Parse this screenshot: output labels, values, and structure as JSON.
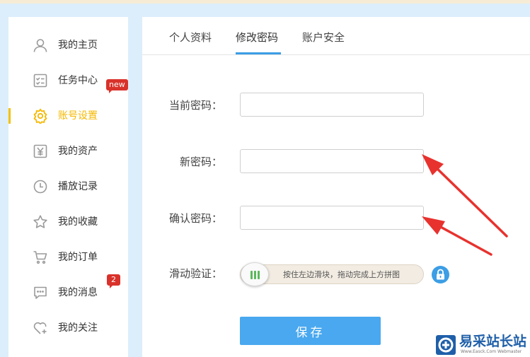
{
  "sidebar": {
    "items": [
      {
        "label": "我的主页",
        "icon": "user-icon"
      },
      {
        "label": "任务中心",
        "icon": "task-list-icon",
        "badge": "new"
      },
      {
        "label": "账号设置",
        "icon": "gear-icon",
        "active": true
      },
      {
        "label": "我的资产",
        "icon": "yen-icon"
      },
      {
        "label": "播放记录",
        "icon": "clock-icon"
      },
      {
        "label": "我的收藏",
        "icon": "star-icon"
      },
      {
        "label": "我的订单",
        "icon": "cart-icon"
      },
      {
        "label": "我的消息",
        "icon": "message-icon",
        "badge": "2"
      },
      {
        "label": "我的关注",
        "icon": "heart-plus-icon"
      }
    ]
  },
  "tabs": [
    {
      "label": "个人资料"
    },
    {
      "label": "修改密码",
      "active": true
    },
    {
      "label": "账户安全"
    }
  ],
  "form": {
    "current_password_label": "当前密码：",
    "new_password_label": "新密码：",
    "confirm_password_label": "确认密码：",
    "slider_label": "滑动验证：",
    "slider_hint": "按住左边滑块，拖动完成上方拼图",
    "save_label": "保存"
  },
  "watermark": {
    "title": "易采站长站",
    "subtitle": "Www.Easck.Com Webmaster"
  },
  "colors": {
    "accent": "#3c9ee5",
    "active_sidebar": "#f5b800",
    "badge": "#d9322b",
    "save_button": "#49a8ef",
    "annotation_arrow": "#e8322e"
  }
}
